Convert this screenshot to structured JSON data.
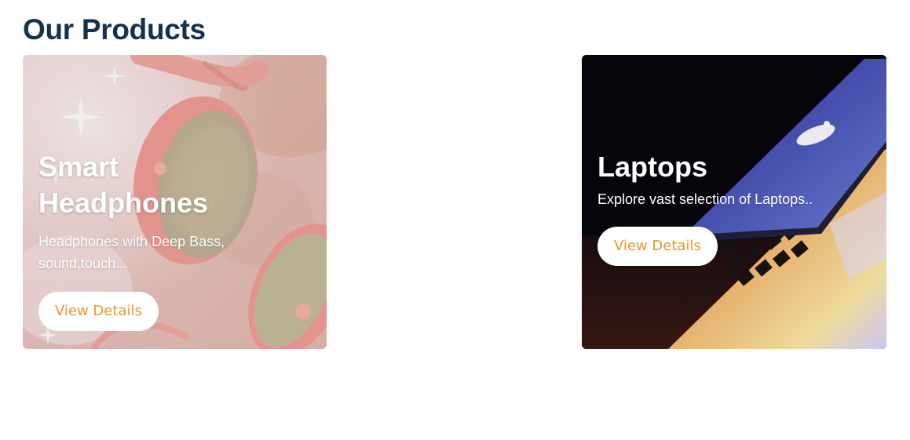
{
  "section": {
    "title": "Our Products"
  },
  "products": [
    {
      "title": "Smart Headphones",
      "description": "Headphones with Deep Bass, sound,touch...",
      "button_label": "View Details",
      "image": "pink-headphones-photo"
    },
    {
      "title": "Laptops",
      "description": "Explore vast selection of Laptops..",
      "button_label": "View Details",
      "image": "laptop-keyboard-photo"
    }
  ],
  "colors": {
    "title": "#15324d",
    "button_text": "#e29a2c",
    "button_bg": "#ffffff",
    "card_text": "#ffffff"
  }
}
